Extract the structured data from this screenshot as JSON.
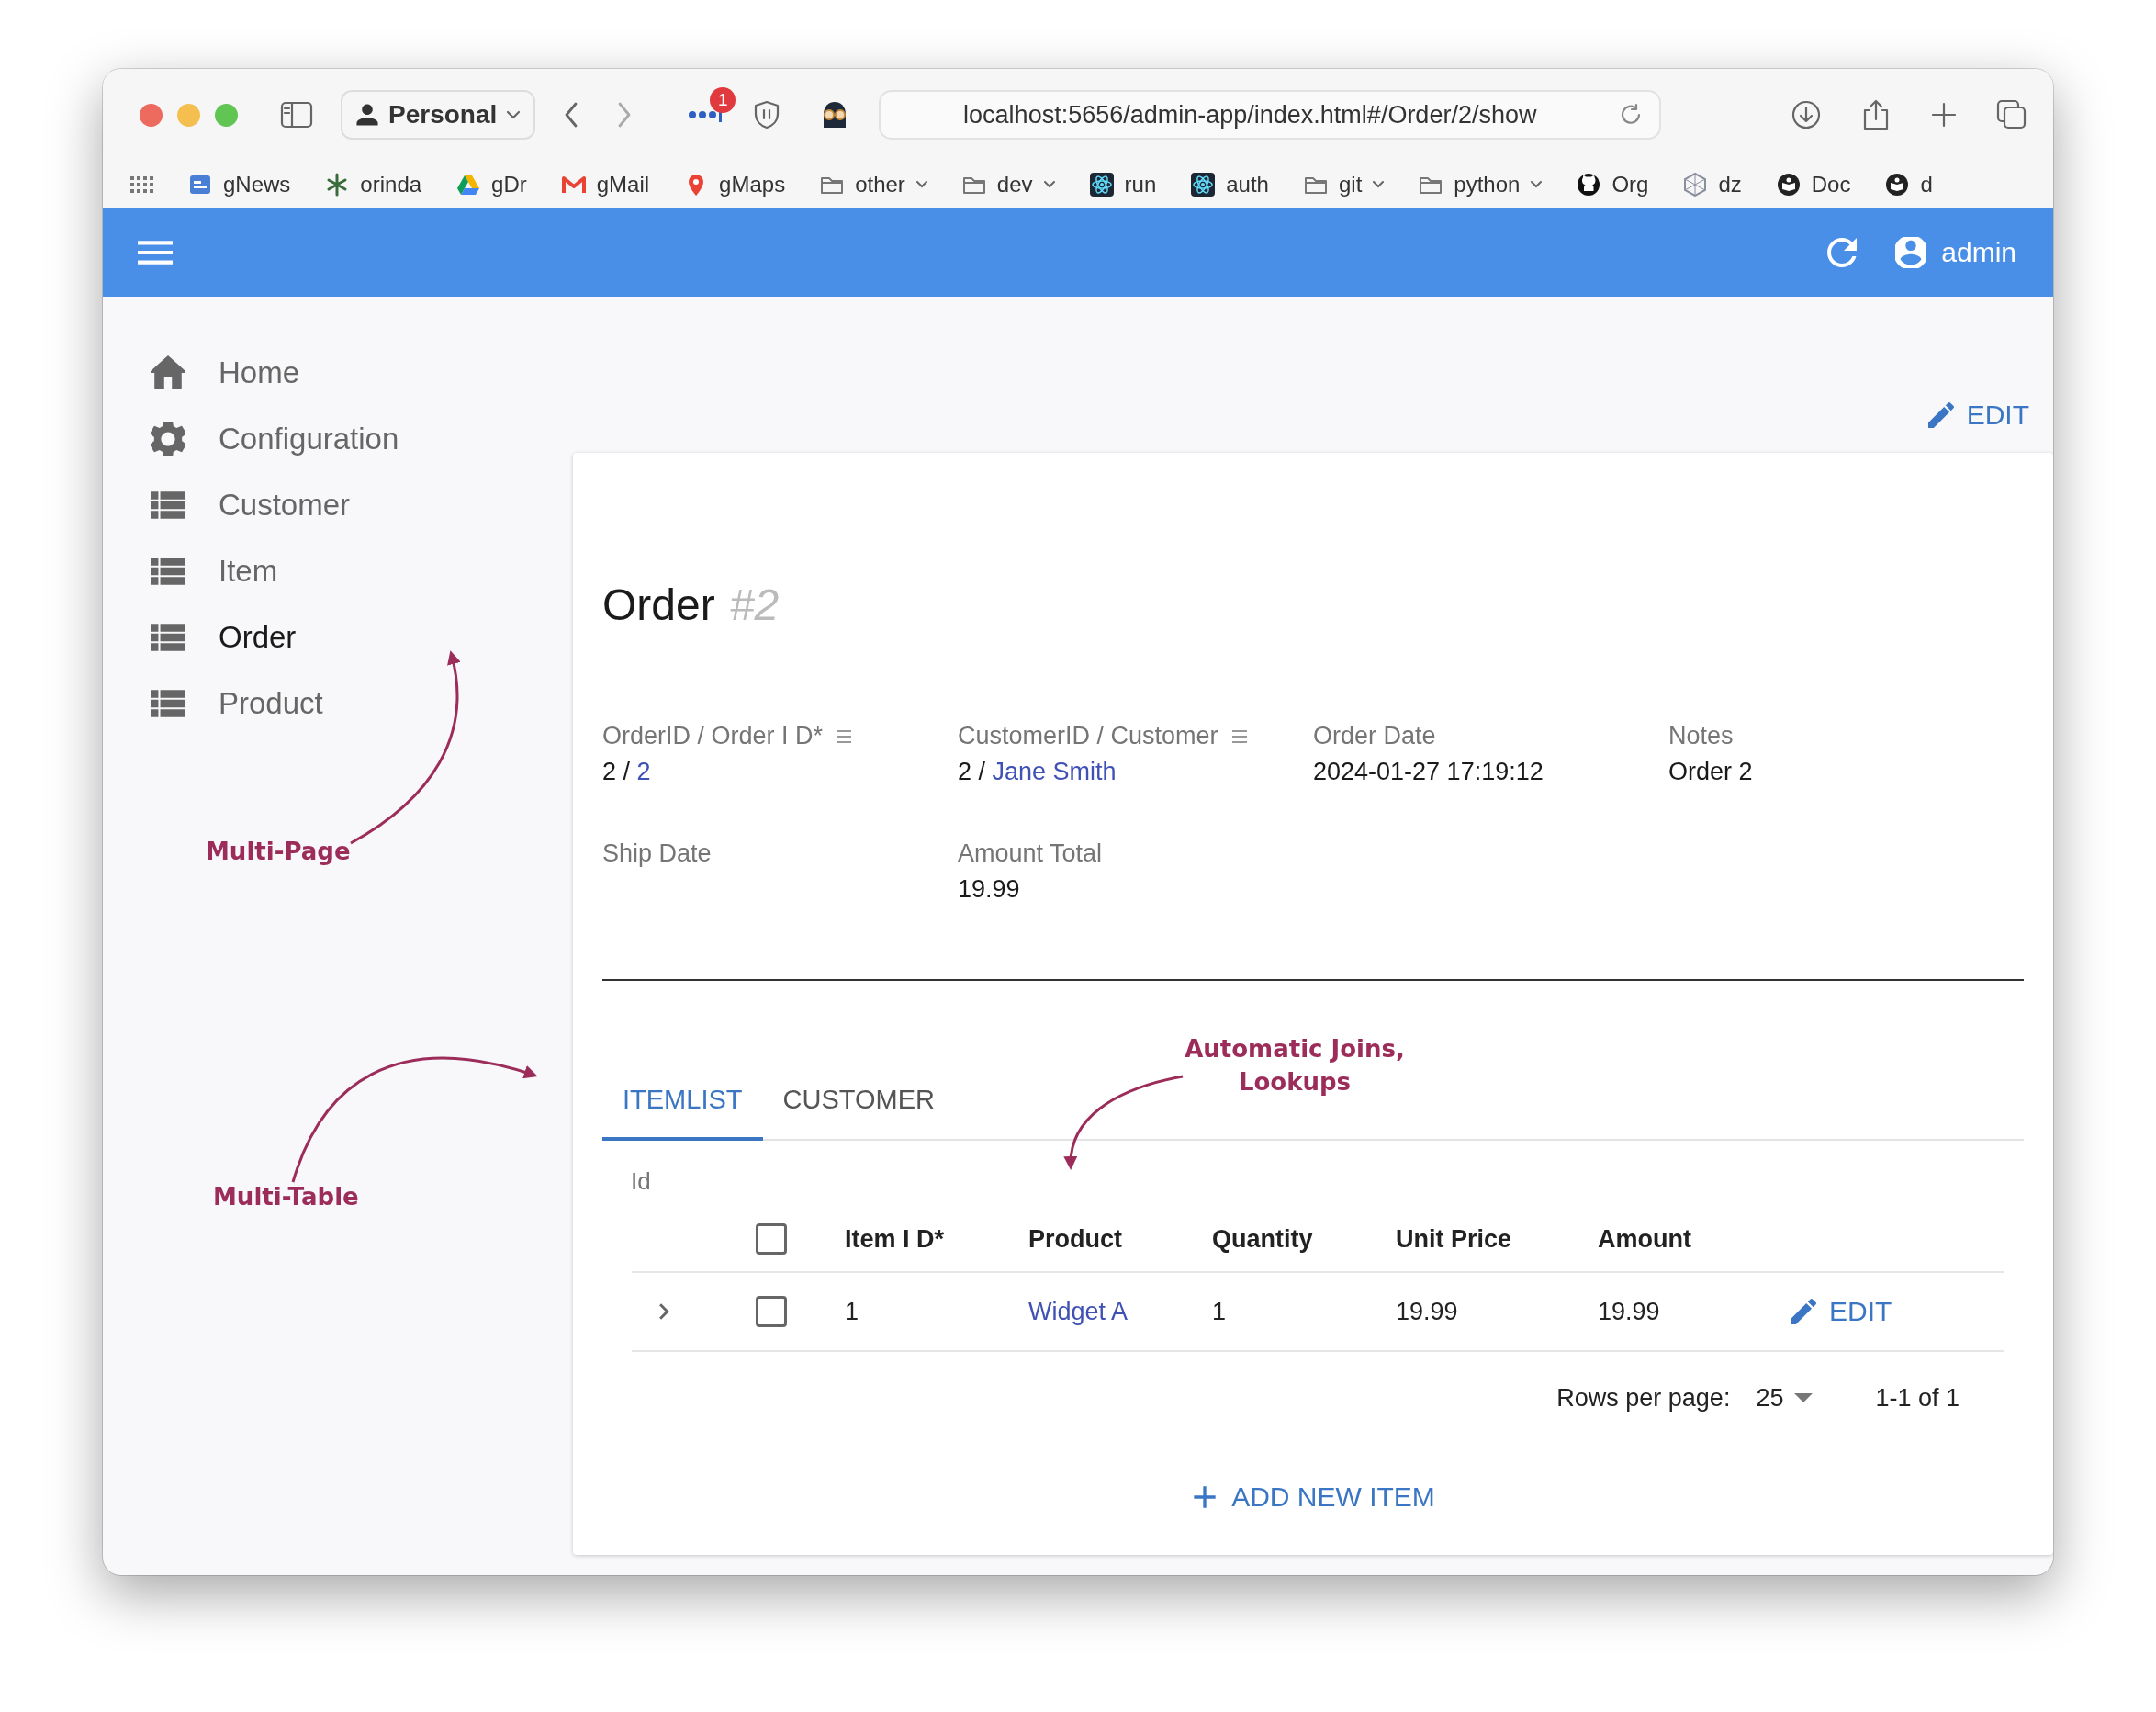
{
  "browser": {
    "profile": "Personal",
    "extension_badge": "1",
    "url": "localhost:5656/admin-app/index.html#/Order/2/show",
    "bookmarks": [
      {
        "label": "gNews",
        "kind": "news"
      },
      {
        "label": "orinda",
        "kind": "plant"
      },
      {
        "label": "gDr",
        "kind": "drive"
      },
      {
        "label": "gMail",
        "kind": "mail"
      },
      {
        "label": "gMaps",
        "kind": "pin"
      },
      {
        "label": "other",
        "kind": "folder"
      },
      {
        "label": "dev",
        "kind": "folder"
      },
      {
        "label": "run",
        "kind": "atom"
      },
      {
        "label": "auth",
        "kind": "atom"
      },
      {
        "label": "git",
        "kind": "folder"
      },
      {
        "label": "python",
        "kind": "folder"
      },
      {
        "label": "Org",
        "kind": "github"
      },
      {
        "label": "dz",
        "kind": "hexagon"
      },
      {
        "label": "Doc",
        "kind": "book"
      },
      {
        "label": "d",
        "kind": "book"
      }
    ]
  },
  "app_bar": {
    "user": "admin"
  },
  "sidebar": {
    "items": [
      {
        "label": "Home",
        "kind": "home",
        "selected": false
      },
      {
        "label": "Configuration",
        "kind": "gear",
        "selected": false
      },
      {
        "label": "Customer",
        "kind": "list",
        "selected": false
      },
      {
        "label": "Item",
        "kind": "list",
        "selected": false
      },
      {
        "label": "Order",
        "kind": "list",
        "selected": true
      },
      {
        "label": "Product",
        "kind": "list",
        "selected": false
      }
    ]
  },
  "edit_button": "EDIT",
  "record": {
    "title": "Order",
    "id": "#2",
    "fields": [
      {
        "label": "OrderID / Order I D*",
        "has_menu": true,
        "value": "2 /",
        "link": "2"
      },
      {
        "label": "CustomerID / Customer",
        "has_menu": true,
        "value": "2 /",
        "link": "Jane Smith"
      },
      {
        "label": "Order Date",
        "has_menu": false,
        "value": "2024-01-27 17:19:12"
      },
      {
        "label": "Notes",
        "has_menu": false,
        "value": "Order 2"
      },
      {
        "label": "Ship Date",
        "has_menu": false
      },
      {
        "label": "Amount Total",
        "has_menu": false,
        "value": "19.99"
      }
    ]
  },
  "tabs": [
    {
      "label": "ITEMLIST",
      "selected": true
    },
    {
      "label": "CUSTOMER",
      "selected": false
    }
  ],
  "table": {
    "caption": "Id",
    "select_all_checked": false,
    "columns": [
      {
        "label": "Item I D*",
        "kind": "text"
      },
      {
        "label": "Product",
        "kind": "link"
      },
      {
        "label": "Quantity",
        "kind": "text"
      },
      {
        "label": "Unit Price",
        "kind": "text"
      },
      {
        "label": "Amount",
        "kind": "text"
      }
    ],
    "rows": [
      {
        "cells": [
          "1",
          "Widget A",
          "1",
          "19.99",
          "19.99"
        ],
        "checked": false,
        "edit": "EDIT"
      }
    ]
  },
  "pagination": {
    "rows_per_page_label": "Rows per page:",
    "rows_per_page": "25",
    "range": "1-1 of 1"
  },
  "add_button": "ADD NEW ITEM",
  "annotations": [
    {
      "text": "Multi-Page"
    },
    {
      "text": "Multi-Table"
    },
    {
      "text": "Automatic Joins, Lookups"
    }
  ]
}
